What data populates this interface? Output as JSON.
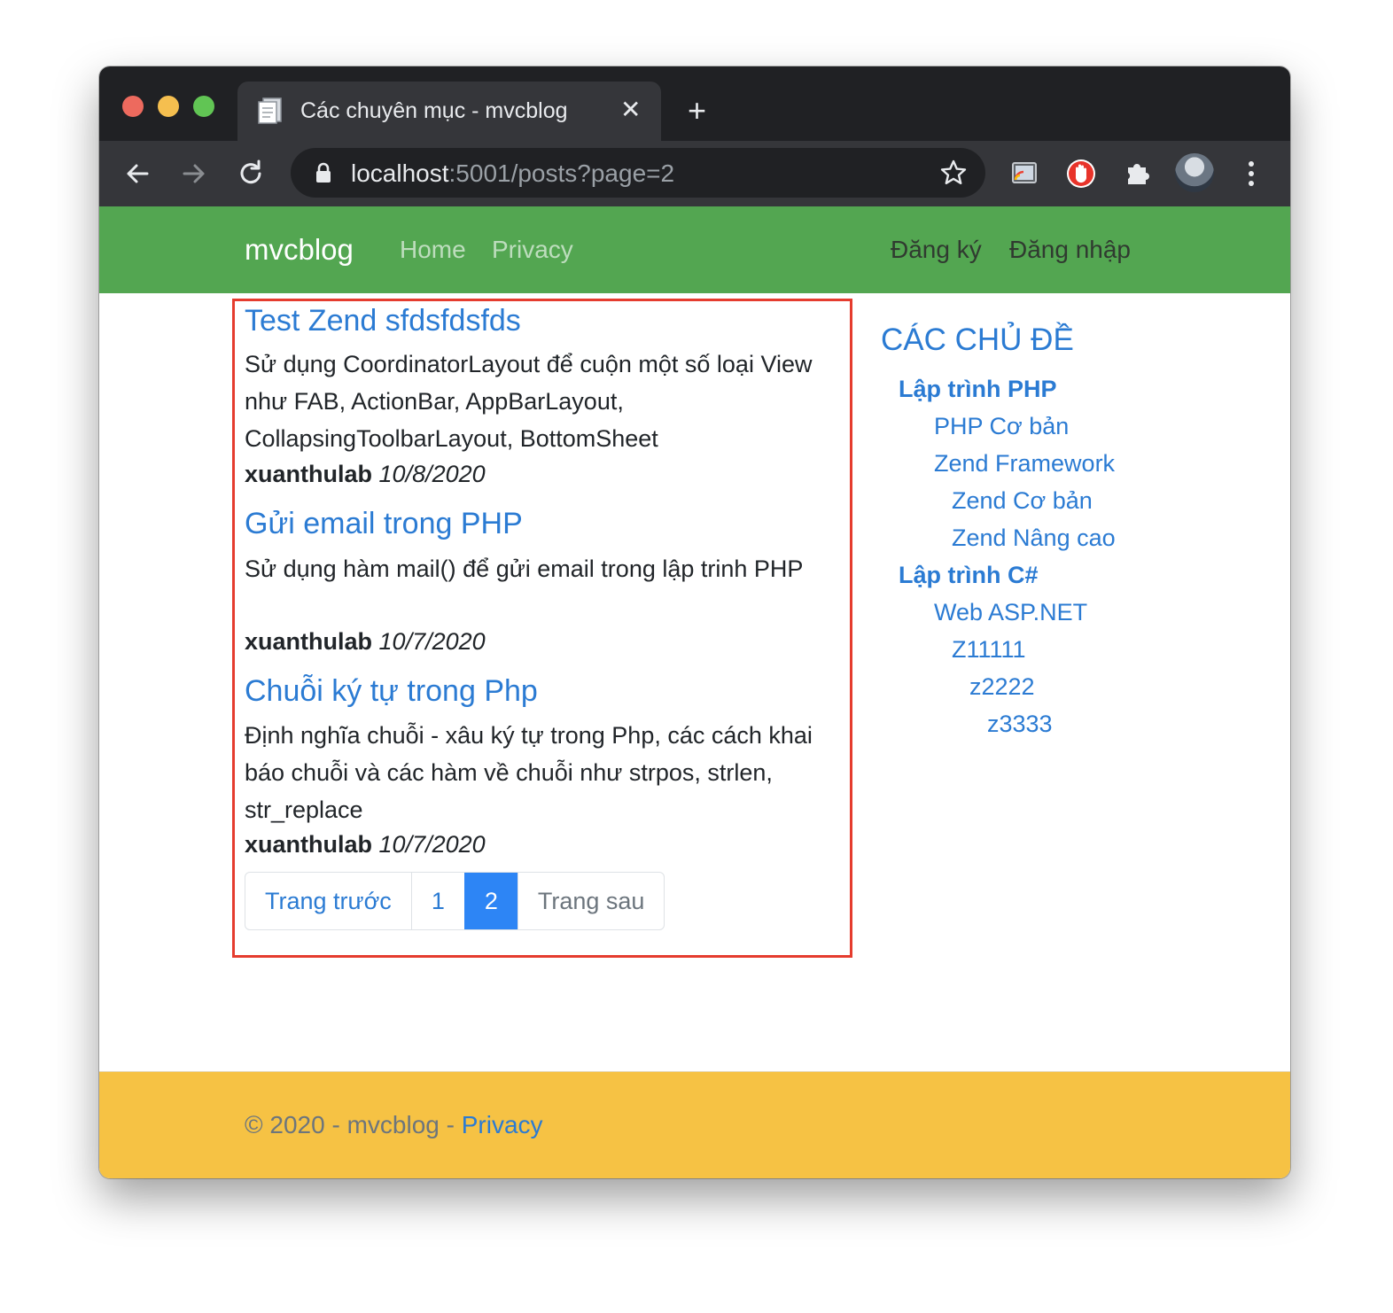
{
  "browser": {
    "tab_title": "Các chuyên mục - mvcblog",
    "close_glyph": "✕",
    "new_tab_glyph": "+",
    "url_host": "localhost",
    "url_rest": ":5001/posts?page=2"
  },
  "navbar": {
    "brand": "mvcblog",
    "links": [
      "Home",
      "Privacy"
    ],
    "register": "Đăng ký",
    "login": "Đăng nhập"
  },
  "posts": [
    {
      "title": "Test Zend sfdsfdsfds",
      "description": "Sử dụng CoordinatorLayout để cuộn một số loại View như FAB, ActionBar, AppBarLayout, CollapsingToolbarLayout, BottomSheet",
      "author": "xuanthulab",
      "date": "10/8/2020"
    },
    {
      "title": "Gửi email trong PHP",
      "description": "Sử dụng hàm mail() để gửi email trong lập trinh PHP",
      "author": "xuanthulab",
      "date": "10/7/2020"
    },
    {
      "title": "Chuỗi ký tự trong Php",
      "description": "Định nghĩa chuỗi - xâu ký tự trong Php, các cách khai báo chuỗi và các hàm về chuỗi như strpos, strlen, str_replace",
      "author": "xuanthulab",
      "date": "10/7/2020"
    }
  ],
  "pagination": {
    "prev": "Trang trước",
    "page1": "1",
    "page2": "2",
    "next": "Trang sau",
    "current": 2
  },
  "sidebar": {
    "heading": "CÁC CHỦ ĐỀ",
    "categories": [
      {
        "label": "Lập trình PHP",
        "level": 0
      },
      {
        "label": "PHP Cơ bản",
        "level": 1
      },
      {
        "label": "Zend Framework",
        "level": 1
      },
      {
        "label": "Zend Cơ bản",
        "level": 2
      },
      {
        "label": "Zend Nâng cao",
        "level": 2
      },
      {
        "label": "Lập trình C#",
        "level": 0
      },
      {
        "label": "Web ASP.NET",
        "level": 1
      },
      {
        "label": "Z11111",
        "level": 2
      },
      {
        "label": "z2222",
        "level": 3
      },
      {
        "label": "z3333",
        "level": 4
      }
    ]
  },
  "footer": {
    "text": "© 2020 - mvcblog - ",
    "link": "Privacy"
  },
  "colors": {
    "navbar": "#53a651",
    "footer": "#f6c244",
    "link": "#2b7bd3",
    "active_page": "#2d85f5",
    "highlight_border": "#e53c2e"
  },
  "icons": [
    "back-arrow-icon",
    "forward-arrow-icon",
    "reload-icon",
    "lock-icon",
    "bookmark-star-icon",
    "cast-icon",
    "adblock-icon",
    "extensions-puzzle-icon",
    "profile-avatar",
    "chrome-menu-icon"
  ]
}
